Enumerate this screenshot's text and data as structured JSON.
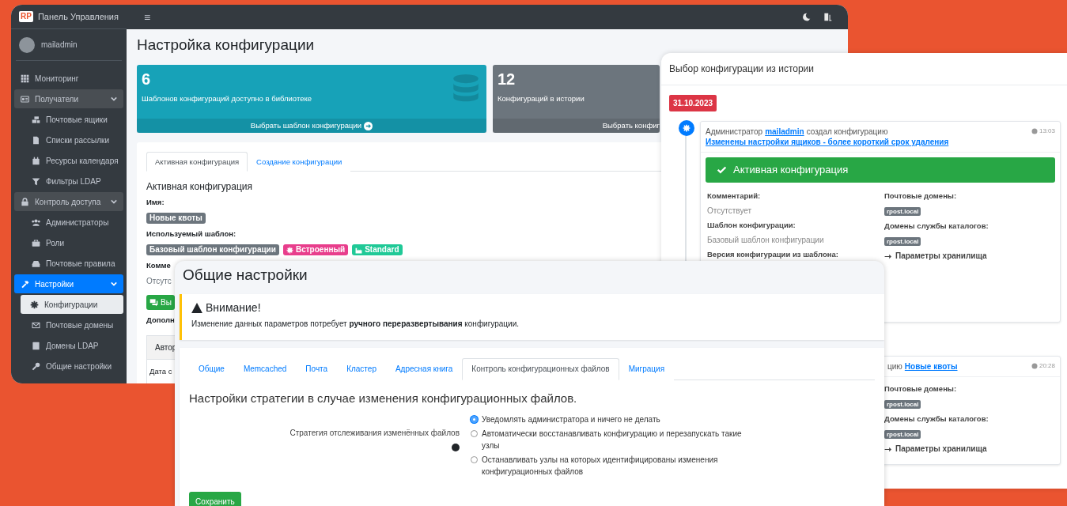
{
  "main_window": {
    "brand": {
      "logo": "RP",
      "title": "Панель Управления"
    },
    "user": {
      "name": "mailadmin"
    },
    "menu_glyph": "≡",
    "sidebar": {
      "items": [
        {
          "label": "Мониторинг",
          "selected": false
        },
        {
          "label": "Получатели",
          "selected": false,
          "expanded": true,
          "children": [
            {
              "label": "Почтовые ящики",
              "selected": false
            },
            {
              "label": "Списки рассылки",
              "selected": false
            },
            {
              "label": "Ресурсы календаря",
              "selected": false
            },
            {
              "label": "Фильтры LDAP",
              "selected": false
            }
          ]
        },
        {
          "label": "Контроль доступа",
          "selected": false,
          "expanded": true,
          "children": [
            {
              "label": "Администраторы",
              "selected": false
            },
            {
              "label": "Роли",
              "selected": false
            },
            {
              "label": "Почтовые правила",
              "selected": false
            }
          ]
        },
        {
          "label": "Настройки",
          "selected": true,
          "expanded": true,
          "children": [
            {
              "label": "Конфигурации",
              "selected": true
            },
            {
              "label": "Почтовые домены",
              "selected": false
            },
            {
              "label": "Домены LDAP",
              "selected": false
            },
            {
              "label": "Общие настройки",
              "selected": false
            }
          ]
        }
      ]
    },
    "page_title": "Настройка конфигурации",
    "info_boxes": [
      {
        "kind": "library",
        "value": "6",
        "caption": "Шаблонов конфигураций доступно в библиотеке",
        "footer": "Выбрать шаблон конфигурации"
      },
      {
        "kind": "history",
        "value": "12",
        "caption": "Конфигураций в истории",
        "footer": "Выбрать конфиг"
      }
    ],
    "tabs": [
      {
        "label": "Активная конфигурация",
        "selected": true
      },
      {
        "label": "Создание конфигурации",
        "selected": false
      }
    ],
    "section_title": "Активная конфигурация",
    "fields": [
      {
        "label": "Имя:",
        "badges": [
          {
            "kind": "plain",
            "text": "Новые квоты",
            "color": "#6c757d"
          }
        ]
      },
      {
        "label": "Используемый шаблон:",
        "badges": [
          {
            "kind": "plain",
            "text": "Базовый шаблон конфигурации",
            "color": "#6c757d"
          },
          {
            "kind": "builtin",
            "text": "Встроенный",
            "color": "#e83e8c"
          },
          {
            "kind": "standard",
            "text": "Standard",
            "color": "#20c997"
          }
        ]
      },
      {
        "label": "Комме",
        "value": "Отсутс"
      }
    ],
    "action_button": "Вы",
    "subheading": "Дополн",
    "table": {
      "columns": [
        "Автор"
      ],
      "rows": [
        [
          "Дата с"
        ]
      ]
    }
  },
  "history_dialog": {
    "title": "Выбор конфигурации из истории",
    "date": "31.10.2023",
    "entries": [
      {
        "kind": "full",
        "message": [
          {
            "text": "Администратор",
            "link": false
          },
          {
            "text": "mailadmin",
            "link": true
          },
          {
            "text": "создал конфигурацию",
            "link": false
          },
          {
            "text": "Изменены настройки ящиков - более короткий срок удаления",
            "link": true
          }
        ],
        "time": "13:03",
        "status": "Активная конфигурация",
        "details": [
          {
            "label": "Комментарий:",
            "value": "Отсутствует"
          },
          {
            "label": "Шаблон конфигурации:",
            "value": "Базовый шаблон конфигурации"
          },
          {
            "label": "Версия конфигурации из шаблона:"
          }
        ],
        "domains": [
          {
            "label": "Почтовые домены:",
            "tags": [
              "rpost.local"
            ]
          },
          {
            "label": "Домены службы каталогов:",
            "tags": [
              "rpost.local"
            ]
          }
        ],
        "storage_link": "Параметры хранилища"
      },
      {
        "kind": "partial",
        "message": [
          {
            "text": "цию",
            "link": false
          },
          {
            "text": "Новые квоты",
            "link": true
          }
        ],
        "time": "20:28",
        "domains": [
          {
            "label": "Почтовые домены:",
            "tags": [
              "rpost.local"
            ]
          },
          {
            "label": "Домены службы каталогов:",
            "tags": [
              "rpost.local"
            ]
          }
        ],
        "storage_link": "Параметры хранилища"
      }
    ]
  },
  "settings_window": {
    "title": "Общие настройки",
    "alert": {
      "title": "Внимание!",
      "message": "Изменение данных параметров потребует **ручного переразвертывания** конфигурации."
    },
    "tabs": [
      {
        "label": "Общие",
        "selected": false
      },
      {
        "label": "Memcached",
        "selected": false
      },
      {
        "label": "Почта",
        "selected": false
      },
      {
        "label": "Кластер",
        "selected": false
      },
      {
        "label": "Адресная книга",
        "selected": false
      },
      {
        "label": "Контроль конфигурационных файлов",
        "selected": true
      },
      {
        "label": "Миграция",
        "selected": false
      }
    ],
    "section_title": "Настройки стратегии в случае изменения конфигурационных файлов.",
    "field": {
      "label": "Стратегия отслеживания изменённых файлов",
      "options": [
        {
          "label": "Уведомлять администратора и ничего не делать",
          "selected": true
        },
        {
          "label": "Автоматически восстанавливать конфигурацию и перезапускать такие узлы",
          "selected": false
        },
        {
          "label": "Останавливать узлы на которых идентифицированы изменения конфигурационных файлов",
          "selected": false
        }
      ]
    },
    "save_button": "Сохранить"
  }
}
